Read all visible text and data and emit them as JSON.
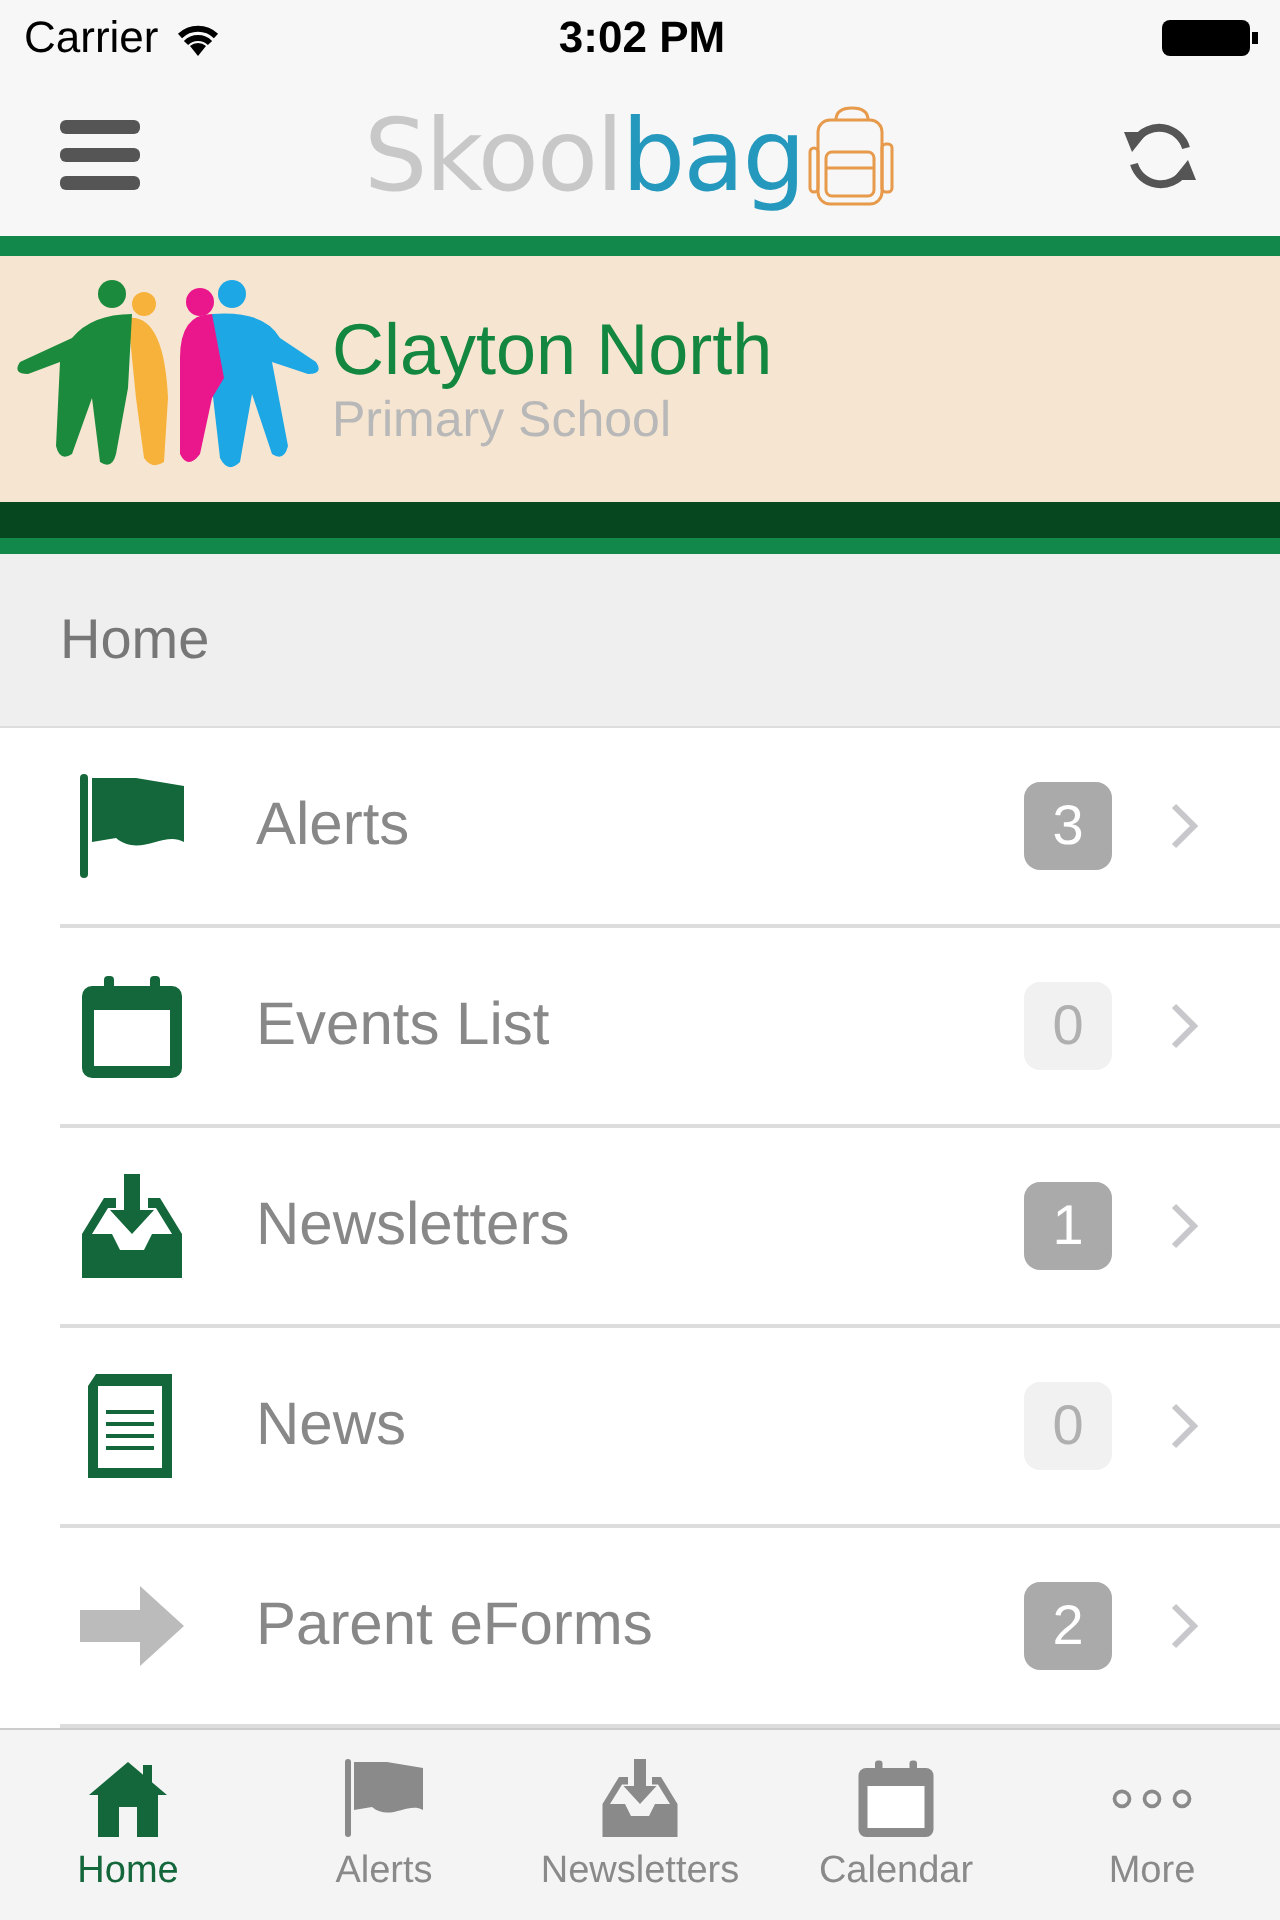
{
  "status_bar": {
    "carrier": "Carrier",
    "time": "3:02 PM"
  },
  "nav_bar": {
    "logo_first": "Skool",
    "logo_second": "bag"
  },
  "banner": {
    "school_name": "Clayton North",
    "school_type": "Primary School"
  },
  "section_header": "Home",
  "menu_items": [
    {
      "kind": "flag",
      "label": "Alerts",
      "count": "3",
      "badge_active": true
    },
    {
      "kind": "calendar",
      "label": "Events List",
      "count": "0",
      "badge_active": false
    },
    {
      "kind": "inbox",
      "label": "Newsletters",
      "count": "1",
      "badge_active": true
    },
    {
      "kind": "document",
      "label": "News",
      "count": "0",
      "badge_active": false
    },
    {
      "kind": "arrow",
      "label": "Parent eForms",
      "count": "2",
      "badge_active": true
    }
  ],
  "tabs": [
    {
      "kind": "home",
      "label": "Home",
      "selected": true
    },
    {
      "kind": "flag",
      "label": "Alerts",
      "selected": false
    },
    {
      "kind": "inbox",
      "label": "Newsletters",
      "selected": false
    },
    {
      "kind": "calendar",
      "label": "Calendar",
      "selected": false
    },
    {
      "kind": "dots",
      "label": "More",
      "selected": false
    }
  ]
}
